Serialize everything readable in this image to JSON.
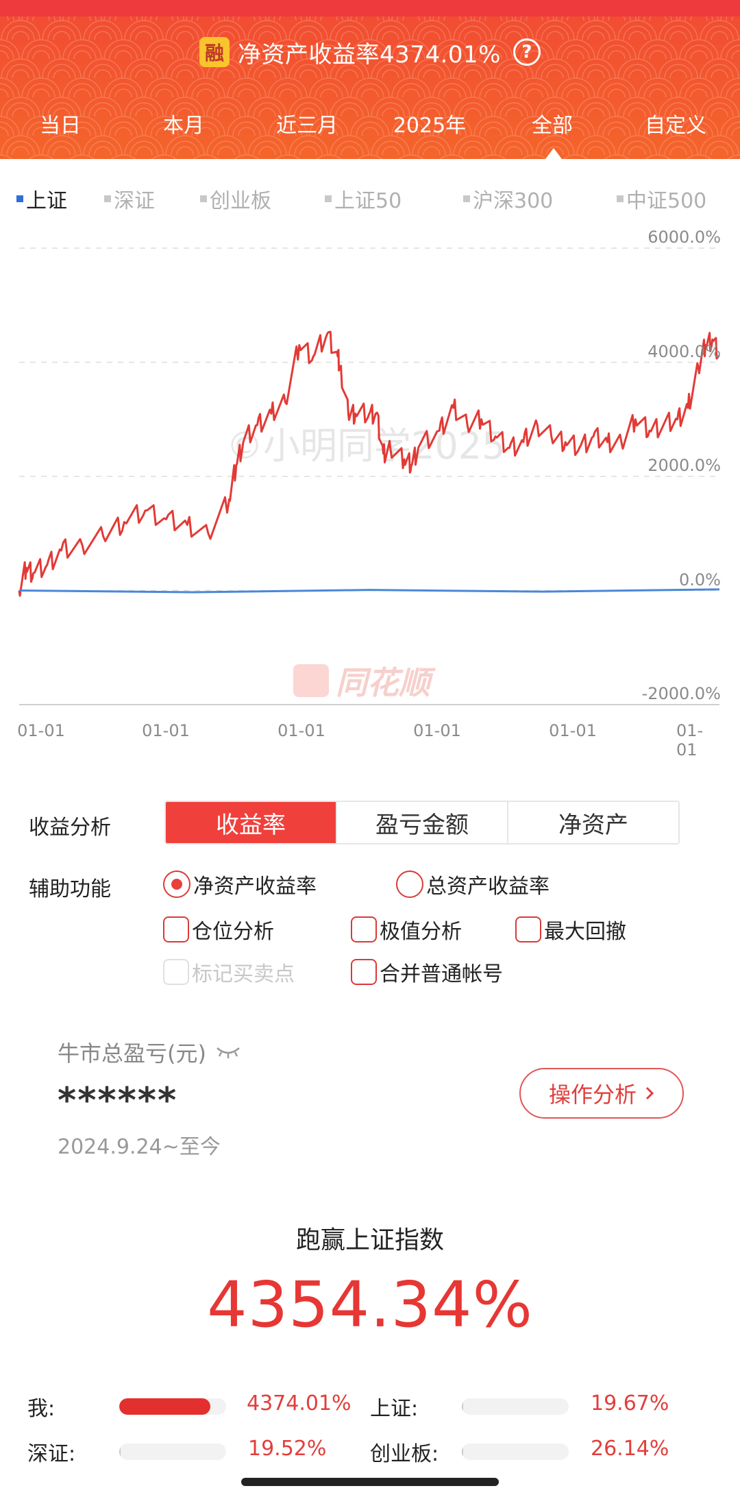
{
  "header": {
    "badge": "融",
    "title": "净资产收益率4374.01%",
    "help": "?",
    "periods": [
      "当日",
      "本月",
      "近三月",
      "2025年",
      "全部",
      "自定义"
    ],
    "active_period": "全部"
  },
  "indices": [
    "上证",
    "深证",
    "创业板",
    "上证50",
    "沪深300",
    "中证500"
  ],
  "active_index": "上证",
  "chart_data": {
    "type": "line",
    "title": "",
    "xlabel": "",
    "ylabel": "",
    "y_ticks": [
      "6000.0%",
      "4000.0%",
      "2000.0%",
      "0.0%",
      "-2000.0%"
    ],
    "x_ticks": [
      "01-01",
      "01-01",
      "01-01",
      "01-01",
      "01-01",
      "01-01"
    ],
    "ylim": [
      -2000,
      6000
    ],
    "series": [
      {
        "color": "#e23a36",
        "x": [
          0,
          0.01,
          0.02,
          0.04,
          0.06,
          0.09,
          0.12,
          0.15,
          0.18,
          0.21,
          0.24,
          0.27,
          0.3,
          0.31,
          0.32,
          0.34,
          0.36,
          0.38,
          0.4,
          0.42,
          0.44,
          0.455,
          0.46,
          0.47,
          0.48,
          0.5,
          0.51,
          0.52,
          0.53,
          0.55,
          0.56,
          0.57,
          0.6,
          0.62,
          0.64,
          0.66,
          0.68,
          0.7,
          0.72,
          0.74,
          0.76,
          0.78,
          0.8,
          0.82,
          0.84,
          0.86,
          0.88,
          0.9,
          0.92,
          0.94,
          0.955,
          0.97,
          0.98,
          0.99,
          1.0
        ],
        "y": [
          0,
          400,
          300,
          450,
          700,
          800,
          950,
          1200,
          1400,
          1250,
          1150,
          1000,
          1600,
          2200,
          2600,
          2900,
          3100,
          3300,
          4300,
          4100,
          4500,
          4100,
          3800,
          3100,
          3100,
          3100,
          3100,
          2400,
          2500,
          2300,
          2200,
          2500,
          2800,
          3200,
          2900,
          3000,
          2700,
          2500,
          2600,
          2900,
          2700,
          2600,
          2500,
          2700,
          2600,
          2600,
          3000,
          2800,
          2900,
          3000,
          3200,
          3900,
          4300,
          4400,
          4100
        ]
      },
      {
        "color": "#4a87d8",
        "x": [
          0,
          0.25,
          0.5,
          0.75,
          1.0
        ],
        "y": [
          0,
          -30,
          10,
          -20,
          20
        ]
      }
    ],
    "legend": "none",
    "grid": true
  },
  "analysis": {
    "label": "收益分析",
    "modes": [
      "收益率",
      "盈亏金额",
      "净资产"
    ],
    "active_mode": "收益率"
  },
  "aux": {
    "label": "辅助功能",
    "radio_net": "净资产收益率",
    "radio_total": "总资产收益率",
    "opt_position": "仓位分析",
    "opt_extreme": "极值分析",
    "opt_drawdown": "最大回撤",
    "opt_trades": "标记买卖点",
    "opt_merge": "合并普通帐号"
  },
  "bull": {
    "label": "牛市总盈亏(元)",
    "value": "******",
    "date": "2024.9.24~至今",
    "button": "操作分析"
  },
  "outperform": {
    "label": "跑赢上证指数",
    "value": "4354.34%"
  },
  "compare": [
    {
      "name": "我:",
      "value": "4374.01%",
      "fraction": 0.85
    },
    {
      "name": "上证:",
      "value": "19.67%",
      "fraction": 0.01
    },
    {
      "name": "深证:",
      "value": "19.52%",
      "fraction": 0.01
    },
    {
      "name": "创业板:",
      "value": "26.14%",
      "fraction": 0.01
    }
  ]
}
